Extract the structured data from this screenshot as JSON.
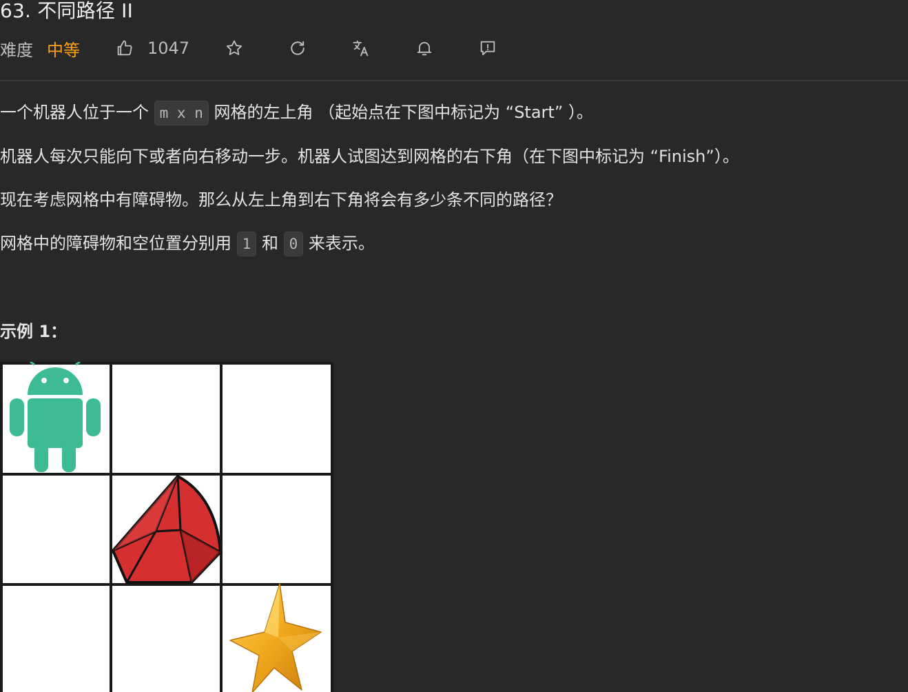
{
  "problem": {
    "title": "63. 不同路径 II",
    "difficulty_label": "难度",
    "difficulty_value": "中等",
    "likes": "1047"
  },
  "toolbar": {
    "icons": [
      "thumbs-up-icon",
      "star-icon",
      "refresh-icon",
      "translate-icon",
      "bell-icon",
      "feedback-icon"
    ]
  },
  "description": {
    "p1": {
      "before": "一个机器人位于一个",
      "code": "m x n",
      "after": "网格的左上角 （起始点在下图中标记为 “Start” ）。"
    },
    "p2": "机器人每次只能向下或者向右移动一步。机器人试图达到网格的右下角（在下图中标记为 “Finish”）。",
    "p3": "现在考虑网格中有障碍物。那么从左上角到右下角将会有多少条不同的路径？",
    "p4": {
      "before": "网格中的障碍物和空位置分别用",
      "code1": "1",
      "mid": "和",
      "code2": "0",
      "after": "来表示。"
    }
  },
  "example": {
    "title": "示例 1："
  },
  "colors": {
    "background": "#282828",
    "accent_difficulty": "#ffa116",
    "android_green": "#3dbb94",
    "ruby_red": "#d62f2f",
    "star_gold": "#f0a91e"
  }
}
